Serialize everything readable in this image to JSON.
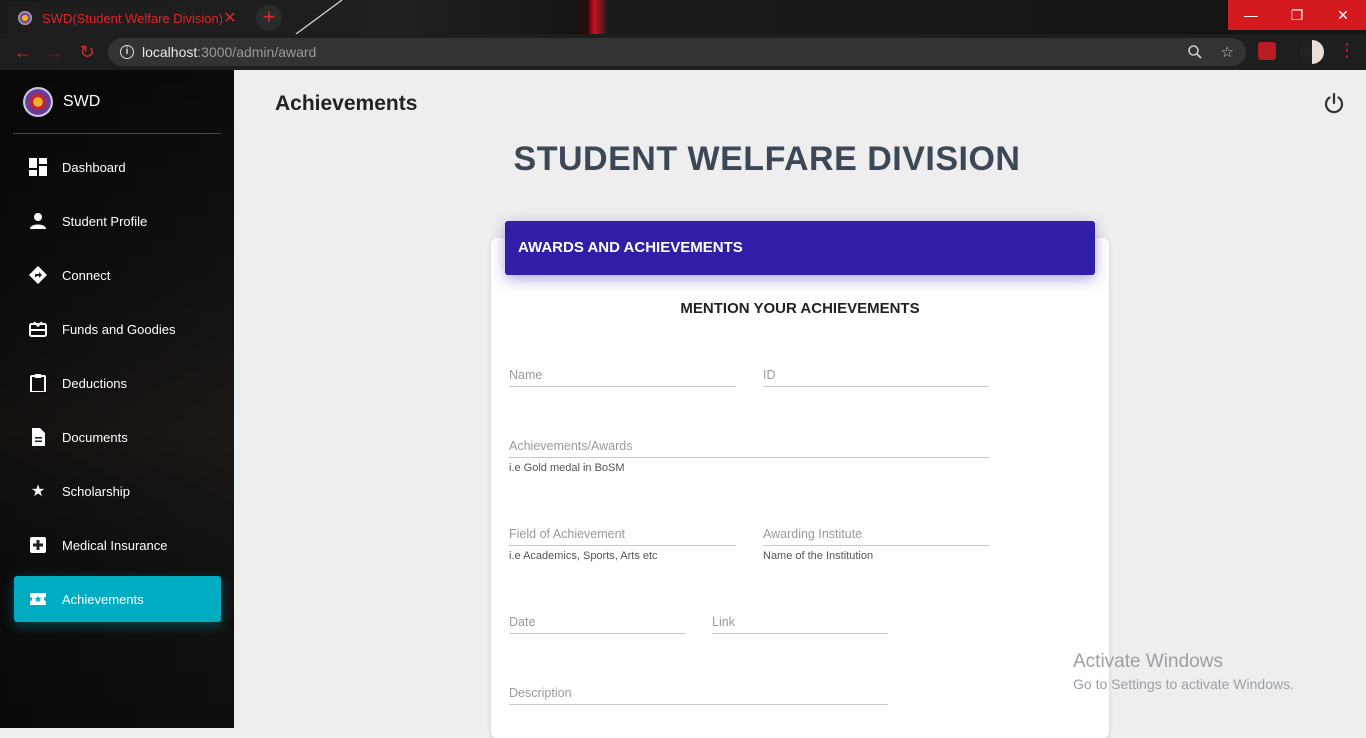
{
  "browser": {
    "tab_title": "SWD(Student Welfare Division)",
    "tab_close": "✕",
    "new_tab": "+",
    "url_host": "localhost",
    "url_path": ":3000/admin/award",
    "win_minimize": "—",
    "win_restore": "❐",
    "win_close": "✕"
  },
  "sidebar": {
    "brand": "SWD",
    "items": [
      {
        "label": "Dashboard",
        "icon": "dashboard-icon"
      },
      {
        "label": "Student Profile",
        "icon": "person-icon"
      },
      {
        "label": "Connect",
        "icon": "directions-icon"
      },
      {
        "label": "Funds and Goodies",
        "icon": "card-giftcard-icon"
      },
      {
        "label": "Deductions",
        "icon": "clipboard-icon"
      },
      {
        "label": "Documents",
        "icon": "document-icon"
      },
      {
        "label": "Scholarship",
        "icon": "star-icon"
      },
      {
        "label": "Medical Insurance",
        "icon": "medical-plus-icon"
      },
      {
        "label": "Achievements",
        "icon": "ticket-star-icon",
        "active": true
      }
    ]
  },
  "main": {
    "page_title": "Achievements",
    "heading": "STUDENT WELFARE DIVISION",
    "card_header": "AWARDS AND ACHIEVEMENTS",
    "card_subtitle": "MENTION YOUR ACHIEVEMENTS",
    "fields": {
      "name": "Name",
      "id": "ID",
      "achievements": "Achievements/Awards",
      "achievements_help": "i.e Gold medal in BoSM",
      "field": "Field of Achievement",
      "field_help": "i.e Academics, Sports, Arts etc",
      "institute": "Awarding Institute",
      "institute_help": "Name of the Institution",
      "date": "Date",
      "link": "Link",
      "description": "Description"
    }
  },
  "watermark": {
    "line1": "Activate Windows",
    "line2": "Go to Settings to activate Windows."
  },
  "colors": {
    "accent_red": "#e0242c",
    "active_cyan": "#00acc1",
    "card_header": "#2f1fa8"
  }
}
